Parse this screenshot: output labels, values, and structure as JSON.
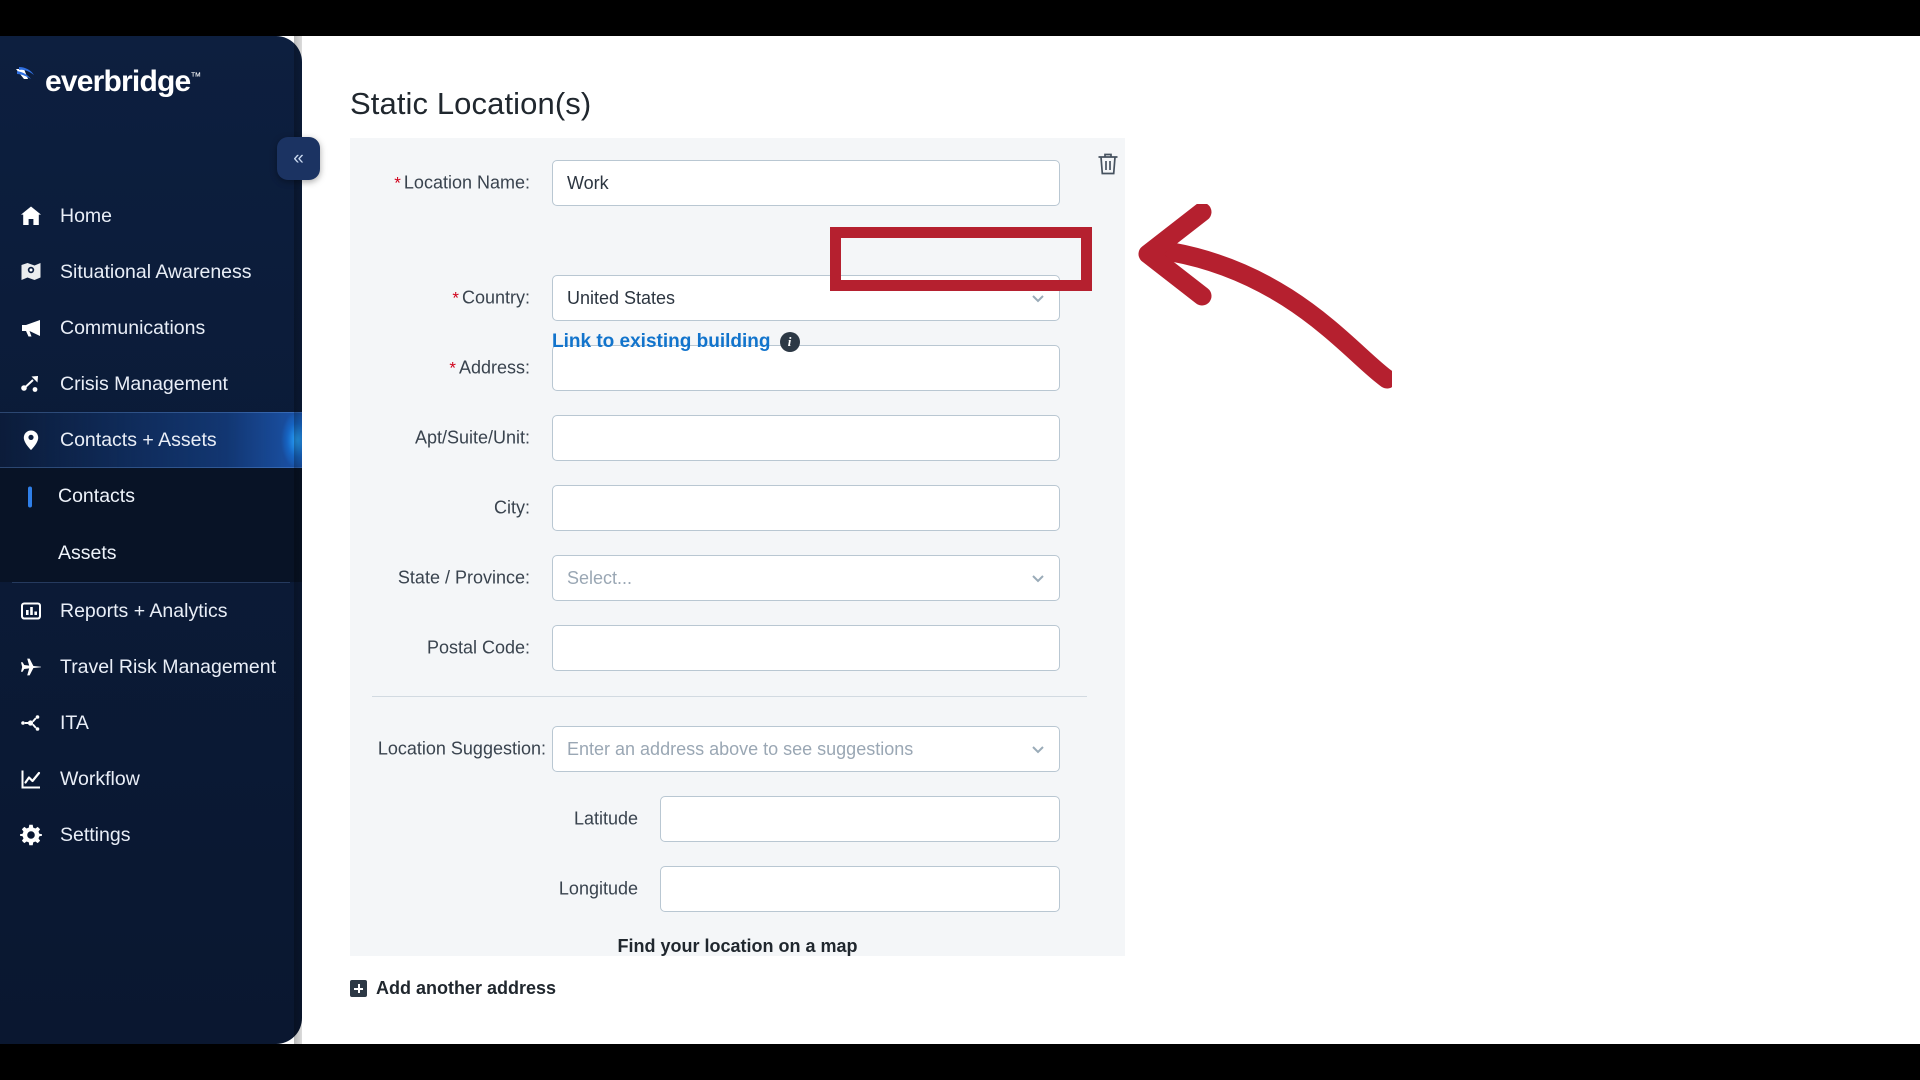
{
  "brand": {
    "name": "everbridge",
    "tm": "™"
  },
  "sidebar": {
    "collapse_label": "«",
    "items": [
      {
        "label": "Home",
        "icon": "home-icon"
      },
      {
        "label": "Situational Awareness",
        "icon": "map-pin-awareness-icon"
      },
      {
        "label": "Communications",
        "icon": "megaphone-icon"
      },
      {
        "label": "Crisis Management",
        "icon": "crisis-nodes-icon"
      },
      {
        "label": "Contacts + Assets",
        "icon": "location-pin-icon",
        "active": true
      },
      {
        "label": "Reports + Analytics",
        "icon": "bar-chart-icon"
      },
      {
        "label": "Travel Risk Management",
        "icon": "airplane-icon"
      },
      {
        "label": "ITA",
        "icon": "ita-nodes-icon"
      },
      {
        "label": "Workflow",
        "icon": "line-chart-icon"
      },
      {
        "label": "Settings",
        "icon": "gear-icon"
      }
    ],
    "sub_items": [
      {
        "label": "Contacts",
        "selected": true
      },
      {
        "label": "Assets",
        "selected": false
      }
    ]
  },
  "page": {
    "title": "Static Location(s)"
  },
  "form": {
    "location_name": {
      "label": "Location Name:",
      "required": true,
      "value": "Work"
    },
    "link_building": {
      "label": "Link to existing building",
      "info_glyph": "i"
    },
    "country": {
      "label": "Country:",
      "required": true,
      "value": "United States"
    },
    "address": {
      "label": "Address:",
      "required": true,
      "value": ""
    },
    "apt": {
      "label": "Apt/Suite/Unit:",
      "required": false,
      "value": ""
    },
    "city": {
      "label": "City:",
      "required": false,
      "value": ""
    },
    "state": {
      "label": "State / Province:",
      "required": false,
      "value": "",
      "placeholder": "Select..."
    },
    "postal": {
      "label": "Postal Code:",
      "required": false,
      "value": ""
    },
    "suggestion": {
      "label": "Location Suggestion:",
      "required": false,
      "value": "",
      "placeholder": "Enter an address above to see suggestions"
    },
    "latitude": {
      "label": "Latitude",
      "required": false,
      "value": ""
    },
    "longitude": {
      "label": "Longitude",
      "required": false,
      "value": ""
    },
    "find_map_label": "Find your location on a map",
    "required_marker": "*"
  },
  "actions": {
    "add_address_label": "Add another address",
    "delete_tooltip": "Delete"
  },
  "colors": {
    "brand_navy": "#0d1f3f",
    "accent_blue": "#1274cc",
    "annotation_red": "#b5202f",
    "required_red": "#d0021b"
  }
}
